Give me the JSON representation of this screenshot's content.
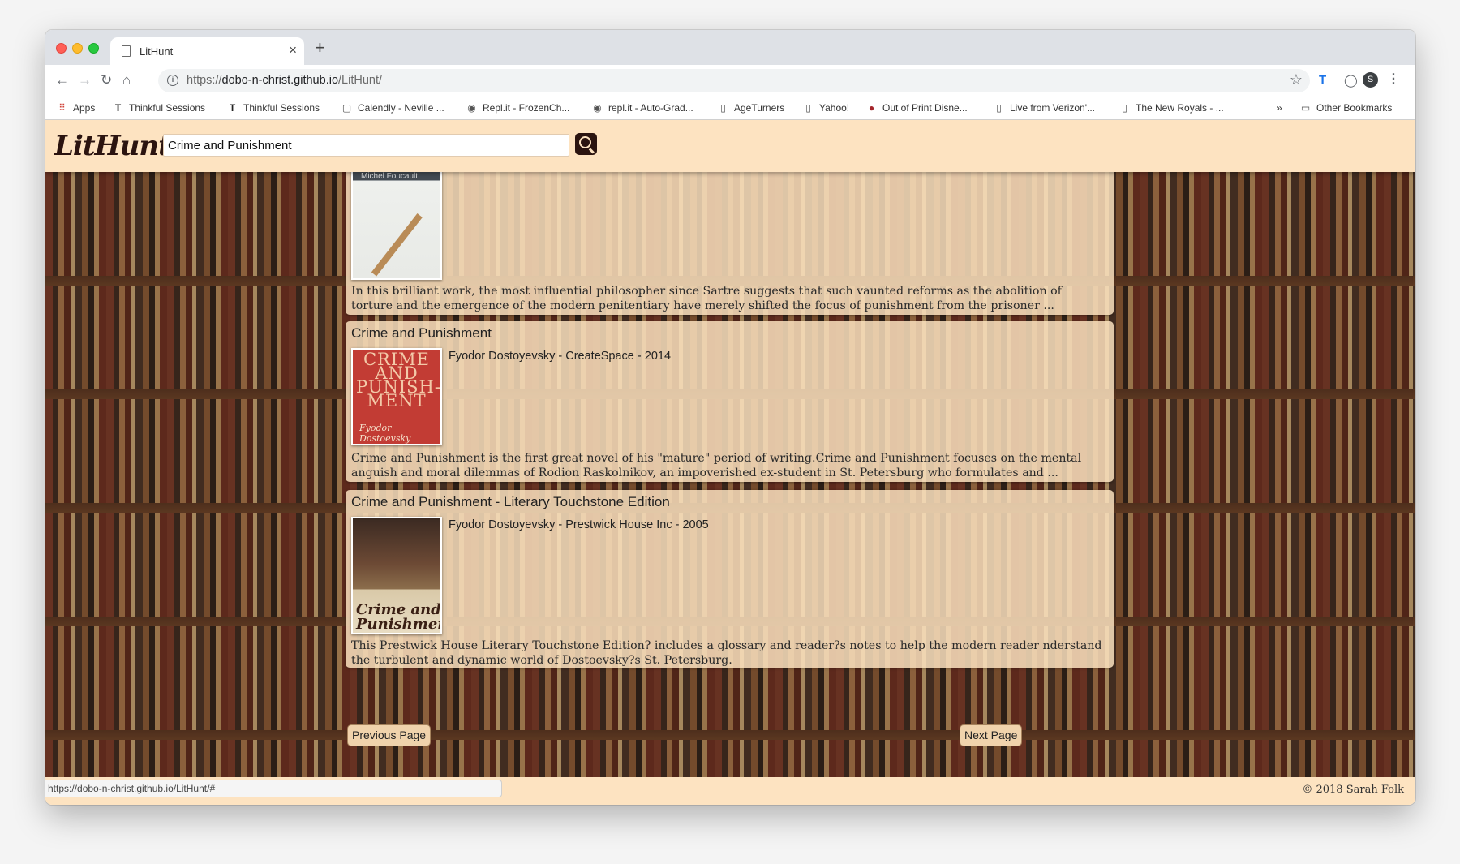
{
  "browser": {
    "tab_title": "LitHunt",
    "url_scheme": "https://",
    "url_host": "dobo-n-christ.github.io",
    "url_path": "/LitHunt/",
    "close_glyph": "×",
    "new_tab_glyph": "+"
  },
  "bookmarks": {
    "items": [
      {
        "label": "Apps",
        "icon": "apps-grid-icon"
      },
      {
        "label": "Thinkful Sessions",
        "icon": "thinkful-icon"
      },
      {
        "label": "Thinkful Sessions",
        "icon": "thinkful-icon"
      },
      {
        "label": "Calendly - Neville ...",
        "icon": "calendly-icon"
      },
      {
        "label": "Repl.it - FrozenCh...",
        "icon": "replit-icon"
      },
      {
        "label": "repl.it - Auto-Grad...",
        "icon": "replit-icon"
      },
      {
        "label": "AgeTurners",
        "icon": "page-icon"
      },
      {
        "label": "Yahoo!",
        "icon": "page-icon"
      },
      {
        "label": "Out of Print Disne...",
        "icon": "disney-icon"
      },
      {
        "label": "Live from Verizon'...",
        "icon": "page-icon"
      },
      {
        "label": "The New Royals - ...",
        "icon": "page-icon"
      }
    ],
    "overflow": "»",
    "other": "Other Bookmarks"
  },
  "app": {
    "logo": "LitHunt",
    "search": {
      "value": "Crime and Punishment"
    }
  },
  "results": [
    {
      "title": "",
      "cover_author": "Michel Foucault",
      "description": "In this brilliant work, the most influential philosopher since Sartre suggests that such vaunted reforms as the abolition of torture and the emergence of the modern penitentiary have merely shifted the focus of punishment from the prisoner ..."
    },
    {
      "title": "Crime and Punishment",
      "meta": "Fyodor Dostoyevsky - CreateSpace - 2014",
      "cover_title": "CRIME AND PUNISH-MENT",
      "cover_author": "Fyodor Dostoevsky",
      "description": "Crime and Punishment is the first great novel of his \"mature\" period of writing.Crime and Punishment focuses on the mental anguish and moral dilemmas of Rodion Raskolnikov, an impoverished ex-student in St. Petersburg who formulates and ..."
    },
    {
      "title": "Crime and Punishment - Literary Touchstone Edition",
      "meta": "Fyodor Dostoyevsky - Prestwick House Inc - 2005",
      "cover_title": "Crime and Punishment",
      "description": "This Prestwick House Literary Touchstone Edition? includes a glossary and reader?s notes to help the modern reader nderstand the turbulent and dynamic world of Dostoevsky?s St. Petersburg."
    }
  ],
  "pager": {
    "previous": "Previous Page",
    "next": "Next Page"
  },
  "footer": {
    "copyright": "© 2018 Sarah Folk"
  },
  "status_url": "https://dobo-n-christ.github.io/LitHunt/#",
  "colors": {
    "header_bg": "#fde3c1",
    "logo": "#2b1410",
    "card_bg": "rgba(253,227,193,0.84)"
  }
}
